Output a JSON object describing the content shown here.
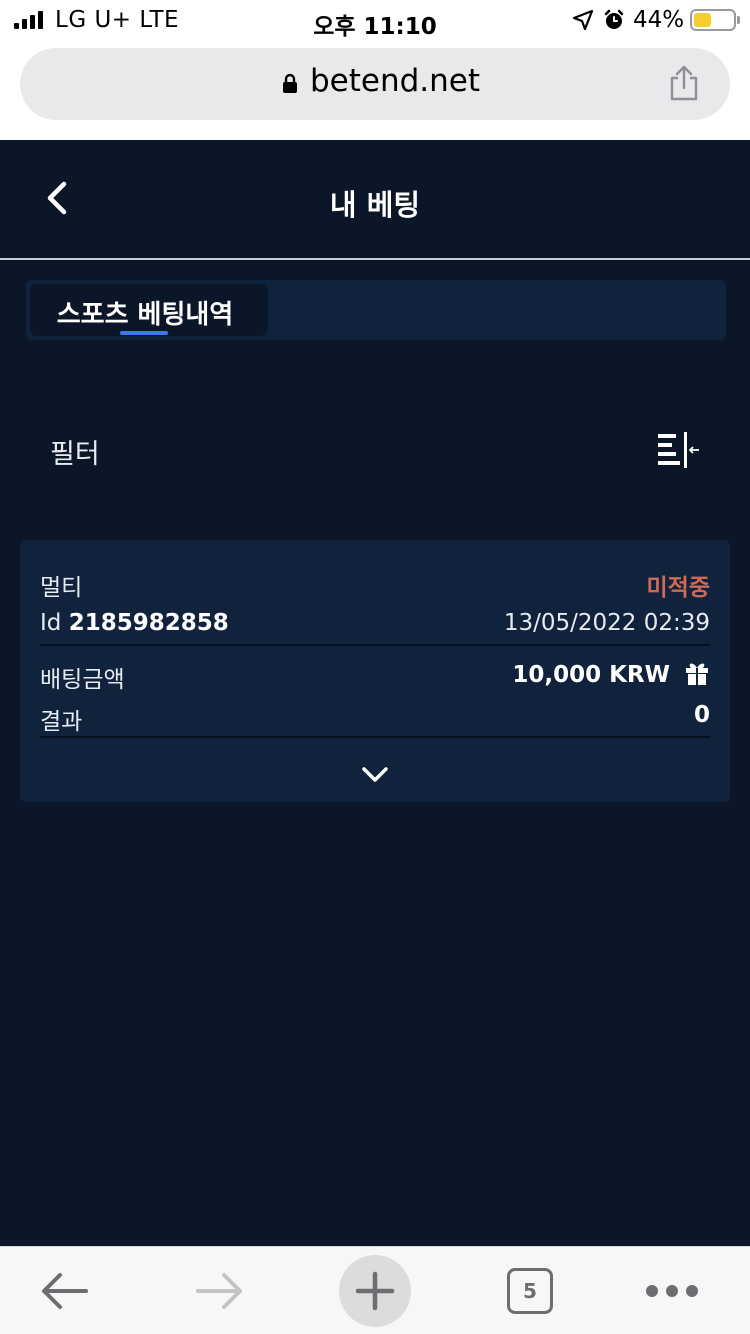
{
  "status_bar": {
    "carrier": "LG U+  LTE",
    "time": "오후 11:10",
    "battery_percent": "44%",
    "battery_level": 0.44
  },
  "browser": {
    "url": "betend.net"
  },
  "header": {
    "title": "내 베팅"
  },
  "tabs": [
    {
      "label": "스포츠 베팅내역",
      "active": true
    }
  ],
  "filter": {
    "label": "필터"
  },
  "bet_card": {
    "type_label": "멀티",
    "status": "미적중",
    "id_label": "Id",
    "id_value": "2185982858",
    "datetime": "13/05/2022 02:39",
    "amount_label": "배팅금액",
    "amount_value": "10,000 KRW",
    "result_label": "결과",
    "result_value": "0"
  },
  "toolbar": {
    "tabs_count": "5"
  },
  "colors": {
    "background": "#0b1628",
    "card": "#11223d",
    "accent": "#3b7ddd",
    "status_lost": "#d06a55"
  }
}
